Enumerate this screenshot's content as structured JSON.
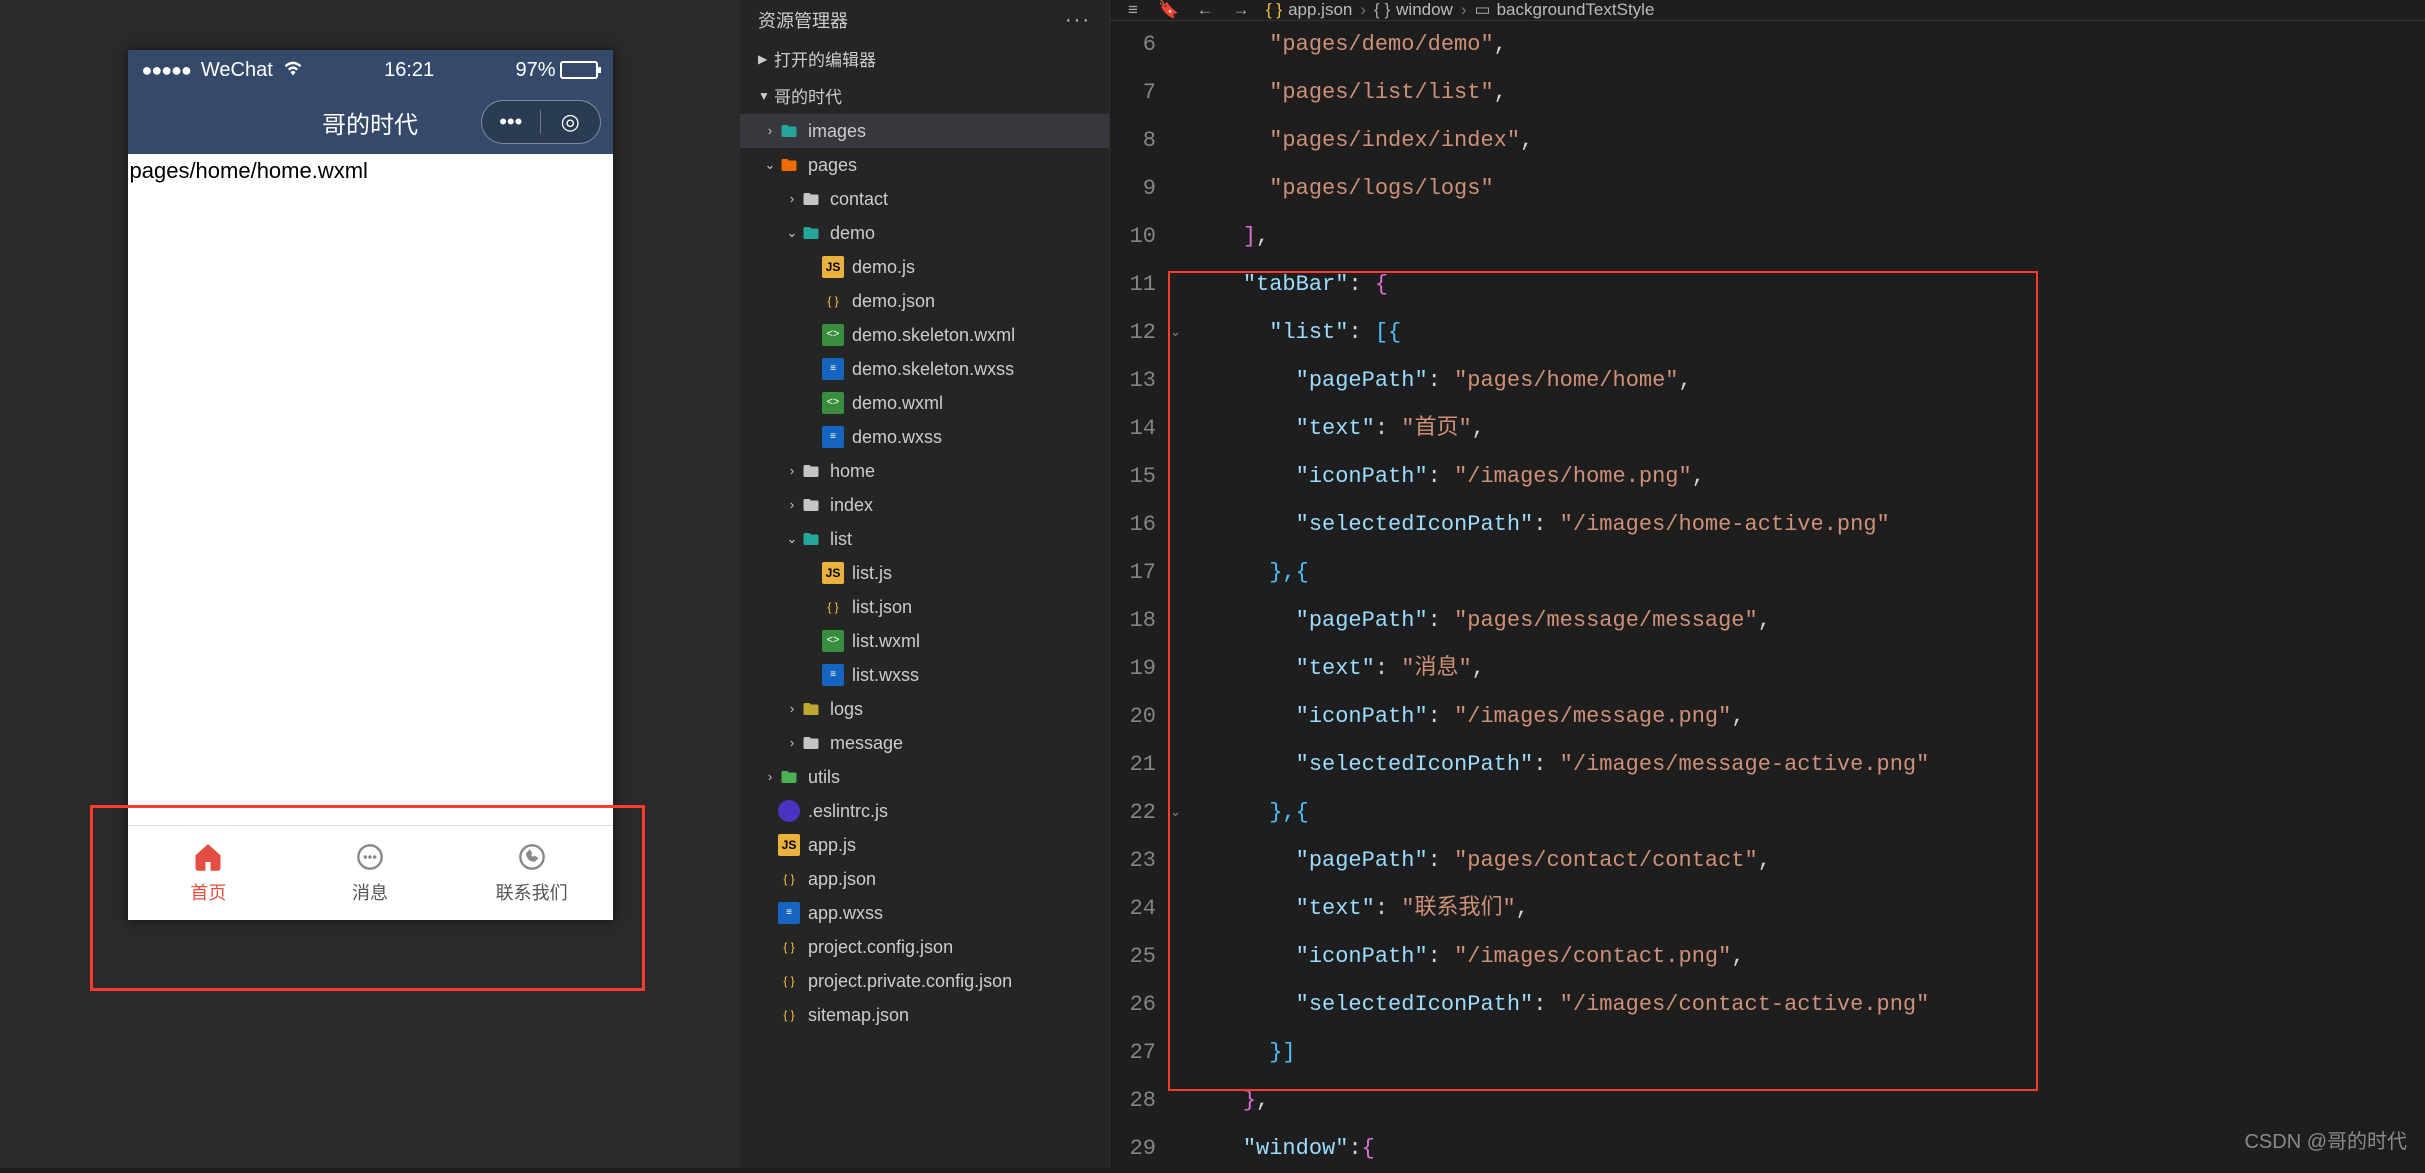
{
  "simulator": {
    "status": {
      "carrier": "WeChat",
      "wifi_icon": "wifi-icon",
      "time": "16:21",
      "battery_pct": "97%"
    },
    "nav_title": "哥的时代",
    "page_text": "pages/home/home.wxml",
    "tabs": [
      {
        "label": "首页",
        "icon": "home-icon",
        "active": true
      },
      {
        "label": "消息",
        "icon": "message-icon",
        "active": false
      },
      {
        "label": "联系我们",
        "icon": "contact-icon",
        "active": false
      }
    ]
  },
  "explorer": {
    "title": "资源管理器",
    "section_editors": "打开的编辑器",
    "section_project": "哥的时代",
    "tree": [
      {
        "depth": 0,
        "kind": "folder",
        "color": "teal",
        "name": "images",
        "chev": "right",
        "selected": true
      },
      {
        "depth": 0,
        "kind": "folder",
        "color": "orange",
        "name": "pages",
        "chev": "down"
      },
      {
        "depth": 1,
        "kind": "folder",
        "color": "",
        "name": "contact",
        "chev": "right"
      },
      {
        "depth": 1,
        "kind": "folder",
        "color": "teal",
        "name": "demo",
        "chev": "down"
      },
      {
        "depth": 2,
        "kind": "js",
        "name": "demo.js"
      },
      {
        "depth": 2,
        "kind": "json",
        "name": "demo.json"
      },
      {
        "depth": 2,
        "kind": "wxml",
        "name": "demo.skeleton.wxml"
      },
      {
        "depth": 2,
        "kind": "wxss",
        "name": "demo.skeleton.wxss"
      },
      {
        "depth": 2,
        "kind": "wxml",
        "name": "demo.wxml"
      },
      {
        "depth": 2,
        "kind": "wxss",
        "name": "demo.wxss"
      },
      {
        "depth": 1,
        "kind": "folder",
        "color": "",
        "name": "home",
        "chev": "right"
      },
      {
        "depth": 1,
        "kind": "folder",
        "color": "",
        "name": "index",
        "chev": "right"
      },
      {
        "depth": 1,
        "kind": "folder",
        "color": "teal",
        "name": "list",
        "chev": "down"
      },
      {
        "depth": 2,
        "kind": "js",
        "name": "list.js"
      },
      {
        "depth": 2,
        "kind": "json",
        "name": "list.json"
      },
      {
        "depth": 2,
        "kind": "wxml",
        "name": "list.wxml"
      },
      {
        "depth": 2,
        "kind": "wxss",
        "name": "list.wxss"
      },
      {
        "depth": 1,
        "kind": "folder",
        "color": "yellow",
        "name": "logs",
        "chev": "right"
      },
      {
        "depth": 1,
        "kind": "folder",
        "color": "",
        "name": "message",
        "chev": "right"
      },
      {
        "depth": 0,
        "kind": "folder",
        "color": "green",
        "name": "utils",
        "chev": "right"
      },
      {
        "depth": 0,
        "kind": "eslint",
        "name": ".eslintrc.js"
      },
      {
        "depth": 0,
        "kind": "js",
        "name": "app.js"
      },
      {
        "depth": 0,
        "kind": "json",
        "name": "app.json"
      },
      {
        "depth": 0,
        "kind": "wxss",
        "name": "app.wxss"
      },
      {
        "depth": 0,
        "kind": "json",
        "name": "project.config.json"
      },
      {
        "depth": 0,
        "kind": "json",
        "name": "project.private.config.json"
      },
      {
        "depth": 0,
        "kind": "json",
        "name": "sitemap.json"
      }
    ]
  },
  "editor": {
    "breadcrumb": [
      {
        "icon": "json",
        "label": "app.json"
      },
      {
        "icon": "brace",
        "label": "window"
      },
      {
        "icon": "text",
        "label": "backgroundTextStyle"
      }
    ],
    "first_line": 6,
    "fold_marks": {
      "12": true,
      "22": true
    },
    "lines": [
      [
        [
          "ind",
          3
        ],
        [
          "str",
          "\"pages/demo/demo\""
        ],
        [
          "pun",
          ","
        ]
      ],
      [
        [
          "ind",
          3
        ],
        [
          "str",
          "\"pages/list/list\""
        ],
        [
          "pun",
          ","
        ]
      ],
      [
        [
          "ind",
          3
        ],
        [
          "str",
          "\"pages/index/index\""
        ],
        [
          "pun",
          ","
        ]
      ],
      [
        [
          "ind",
          3
        ],
        [
          "str",
          "\"pages/logs/logs\""
        ]
      ],
      [
        [
          "ind",
          2
        ],
        [
          "b2",
          "]"
        ],
        [
          "pun",
          ","
        ]
      ],
      [
        [
          "ind",
          2
        ],
        [
          "key",
          "\"tabBar\""
        ],
        [
          "pun",
          ": "
        ],
        [
          "b2",
          "{"
        ]
      ],
      [
        [
          "ind",
          3
        ],
        [
          "key",
          "\"list\""
        ],
        [
          "pun",
          ": "
        ],
        [
          "b3",
          "[{"
        ]
      ],
      [
        [
          "ind",
          4
        ],
        [
          "key",
          "\"pagePath\""
        ],
        [
          "pun",
          ": "
        ],
        [
          "str",
          "\"pages/home/home\""
        ],
        [
          "pun",
          ","
        ]
      ],
      [
        [
          "ind",
          4
        ],
        [
          "key",
          "\"text\""
        ],
        [
          "pun",
          ": "
        ],
        [
          "str",
          "\"首页\""
        ],
        [
          "pun",
          ","
        ]
      ],
      [
        [
          "ind",
          4
        ],
        [
          "key",
          "\"iconPath\""
        ],
        [
          "pun",
          ": "
        ],
        [
          "str",
          "\"/images/home.png\""
        ],
        [
          "pun",
          ","
        ]
      ],
      [
        [
          "ind",
          4
        ],
        [
          "key",
          "\"selectedIconPath\""
        ],
        [
          "pun",
          ": "
        ],
        [
          "str",
          "\"/images/home-active.png\""
        ]
      ],
      [
        [
          "ind",
          3
        ],
        [
          "b3",
          "},{"
        ]
      ],
      [
        [
          "ind",
          4
        ],
        [
          "key",
          "\"pagePath\""
        ],
        [
          "pun",
          ": "
        ],
        [
          "str",
          "\"pages/message/message\""
        ],
        [
          "pun",
          ","
        ]
      ],
      [
        [
          "ind",
          4
        ],
        [
          "key",
          "\"text\""
        ],
        [
          "pun",
          ": "
        ],
        [
          "str",
          "\"消息\""
        ],
        [
          "pun",
          ","
        ]
      ],
      [
        [
          "ind",
          4
        ],
        [
          "key",
          "\"iconPath\""
        ],
        [
          "pun",
          ": "
        ],
        [
          "str",
          "\"/images/message.png\""
        ],
        [
          "pun",
          ","
        ]
      ],
      [
        [
          "ind",
          4
        ],
        [
          "key",
          "\"selectedIconPath\""
        ],
        [
          "pun",
          ": "
        ],
        [
          "str",
          "\"/images/message-active.png\""
        ]
      ],
      [
        [
          "ind",
          3
        ],
        [
          "b3",
          "},{"
        ]
      ],
      [
        [
          "ind",
          4
        ],
        [
          "key",
          "\"pagePath\""
        ],
        [
          "pun",
          ": "
        ],
        [
          "str",
          "\"pages/contact/contact\""
        ],
        [
          "pun",
          ","
        ]
      ],
      [
        [
          "ind",
          4
        ],
        [
          "key",
          "\"text\""
        ],
        [
          "pun",
          ": "
        ],
        [
          "str",
          "\"联系我们\""
        ],
        [
          "pun",
          ","
        ]
      ],
      [
        [
          "ind",
          4
        ],
        [
          "key",
          "\"iconPath\""
        ],
        [
          "pun",
          ": "
        ],
        [
          "str",
          "\"/images/contact.png\""
        ],
        [
          "pun",
          ","
        ]
      ],
      [
        [
          "ind",
          4
        ],
        [
          "key",
          "\"selectedIconPath\""
        ],
        [
          "pun",
          ": "
        ],
        [
          "str",
          "\"/images/contact-active.png\""
        ]
      ],
      [
        [
          "ind",
          3
        ],
        [
          "b3",
          "}]"
        ]
      ],
      [
        [
          "ind",
          2
        ],
        [
          "b2",
          "}"
        ],
        [
          "pun",
          ","
        ]
      ],
      [
        [
          "ind",
          2
        ],
        [
          "key",
          "\"window\""
        ],
        [
          "pun",
          ":"
        ],
        [
          "b2",
          "{"
        ]
      ]
    ]
  },
  "watermark": "CSDN @哥的时代"
}
